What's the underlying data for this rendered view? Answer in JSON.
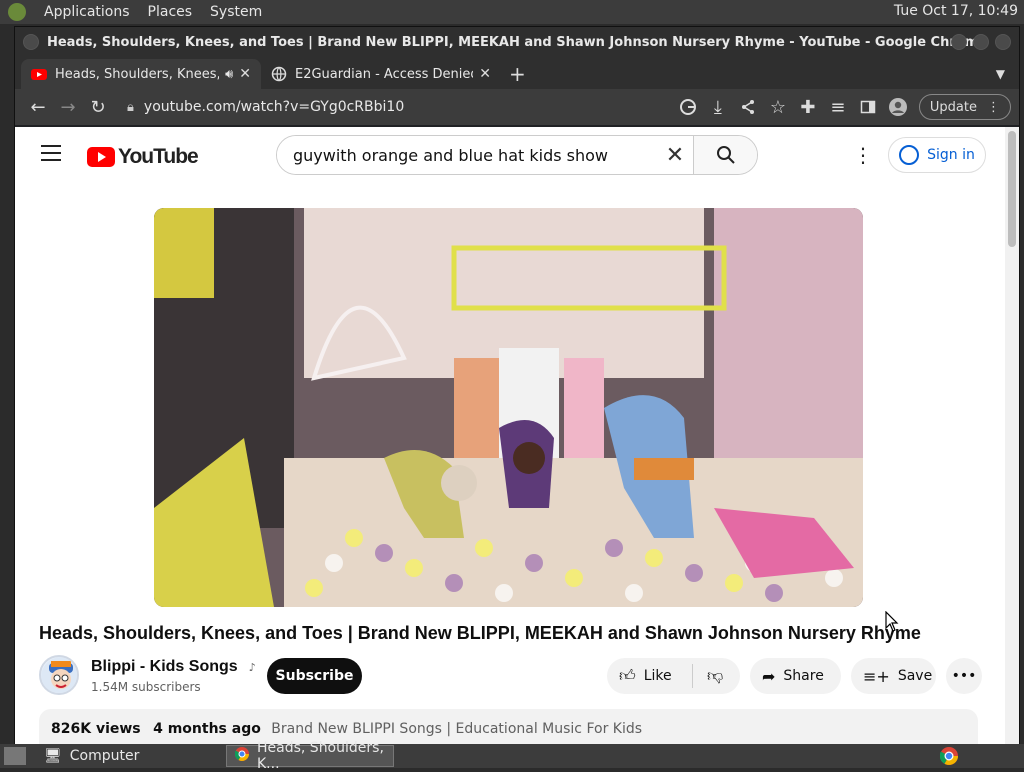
{
  "topbar": {
    "menu": [
      "Applications",
      "Places",
      "System"
    ],
    "clock": "Tue Oct 17, 10:49"
  },
  "window": {
    "title": "Heads, Shoulders, Knees, and Toes | Brand New BLIPPI, MEEKAH and Shawn Johnson Nursery Rhyme - YouTube - Google Chrome"
  },
  "tabs": [
    {
      "label": "Heads, Shoulders, Knees, a",
      "active": true
    },
    {
      "label": "E2Guardian - Access Denied",
      "active": false
    }
  ],
  "toolbar": {
    "url": "youtube.com/watch?v=GYg0cRBbi10",
    "update_label": "Update"
  },
  "youtube": {
    "logo_text": "YouTube",
    "search_value": "guywith orange and blue hat kids show",
    "signin_label": "Sign in",
    "video_title": "Heads, Shoulders, Knees, and Toes | Brand New BLIPPI, MEEKAH and Shawn Johnson Nursery Rhyme",
    "channel_name": "Blippi - Kids Songs",
    "subscribers": "1.54M subscribers",
    "subscribe_label": "Subscribe",
    "like_label": "Like",
    "share_label": "Share",
    "save_label": "Save",
    "views": "826K views",
    "age": "4 months ago",
    "description_tags": "Brand New BLIPPI Songs | Educational Music For Kids"
  },
  "taskbar": {
    "items": [
      "Computer",
      "Heads, Shoulders, K..."
    ]
  },
  "colors": {
    "youtube_red": "#ff0000",
    "signin_blue": "#065fd4"
  }
}
